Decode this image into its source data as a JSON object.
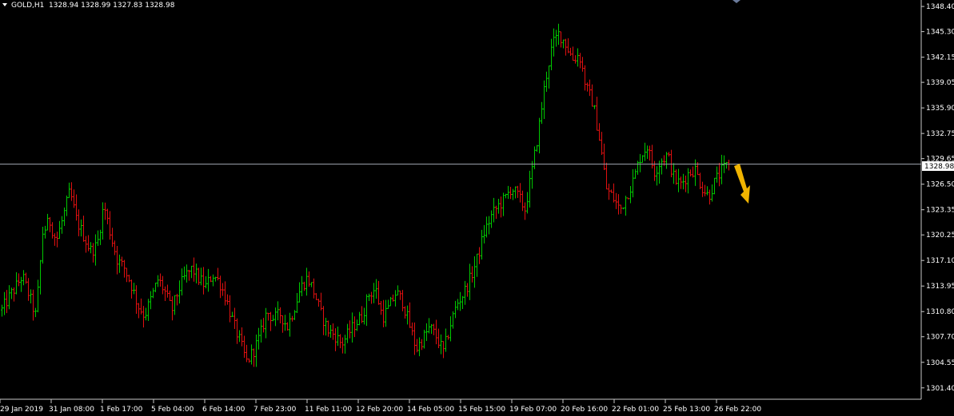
{
  "header": {
    "symbol": "GOLD,H1",
    "ohlc": "1328.94 1328.99 1327.83 1328.98"
  },
  "colors": {
    "background": "#000000",
    "bull": "#00c800",
    "bear": "#e01010",
    "axis": "#c8c8c8",
    "current_line": "#9aa0aa",
    "arrow": "#f0b400"
  },
  "chart_data": {
    "type": "ohlc",
    "title": "",
    "ylim": [
      1300.0,
      1349.0
    ],
    "y_ticks": [
      "1348.40",
      "1345.30",
      "1342.15",
      "1339.05",
      "1335.90",
      "1332.75",
      "1329.65",
      "1326.50",
      "1323.35",
      "1320.25",
      "1317.10",
      "1313.95",
      "1310.80",
      "1307.70",
      "1304.55",
      "1301.40"
    ],
    "x_tick_labels": [
      "29 Jan 2019",
      "31 Jan 08:00",
      "1 Feb 17:00",
      "5 Feb 04:00",
      "6 Feb 14:00",
      "7 Feb 23:00",
      "11 Feb 11:00",
      "12 Feb 20:00",
      "14 Feb 05:00",
      "15 Feb 15:00",
      "19 Feb 07:00",
      "20 Feb 16:00",
      "22 Feb 01:00",
      "25 Feb 13:00",
      "26 Feb 22:00"
    ],
    "current_price": "1328.98",
    "close_path": [
      1311.0,
      1312.5,
      1313.8,
      1315.2,
      1312.8,
      1310.2,
      1320.5,
      1322.0,
      1319.5,
      1322.4,
      1325.6,
      1322.0,
      1320.2,
      1318.3,
      1318.9,
      1324.0,
      1320.3,
      1317.1,
      1316.2,
      1314.2,
      1311.6,
      1310.3,
      1312.5,
      1314.8,
      1313.2,
      1310.9,
      1313.5,
      1315.2,
      1316.1,
      1314.8,
      1313.9,
      1315.4,
      1314.5,
      1312.4,
      1309.5,
      1307.2,
      1304.6,
      1305.9,
      1307.8,
      1310.8,
      1309.9,
      1310.5,
      1308.9,
      1311.2,
      1313.8,
      1315.0,
      1313.1,
      1310.4,
      1308.5,
      1307.9,
      1306.8,
      1308.1,
      1309.3,
      1310.2,
      1312.9,
      1313.6,
      1310.1,
      1311.3,
      1313.2,
      1312.0,
      1309.1,
      1306.2,
      1307.5,
      1308.9,
      1307.6,
      1305.8,
      1309.2,
      1311.8,
      1313.1,
      1315.0,
      1317.4,
      1320.6,
      1322.5,
      1323.8,
      1324.6,
      1326.1,
      1325.0,
      1323.4,
      1328.0,
      1333.2,
      1339.3,
      1343.6,
      1345.1,
      1343.8,
      1341.9,
      1342.5,
      1338.4,
      1336.5,
      1331.9,
      1325.9,
      1324.8,
      1323.3,
      1325.2,
      1327.1,
      1330.0,
      1331.2,
      1328.0,
      1329.4,
      1330.1,
      1327.0,
      1326.5,
      1327.8,
      1328.4,
      1326.2,
      1325.0,
      1326.9,
      1328.2,
      1328.98
    ]
  }
}
